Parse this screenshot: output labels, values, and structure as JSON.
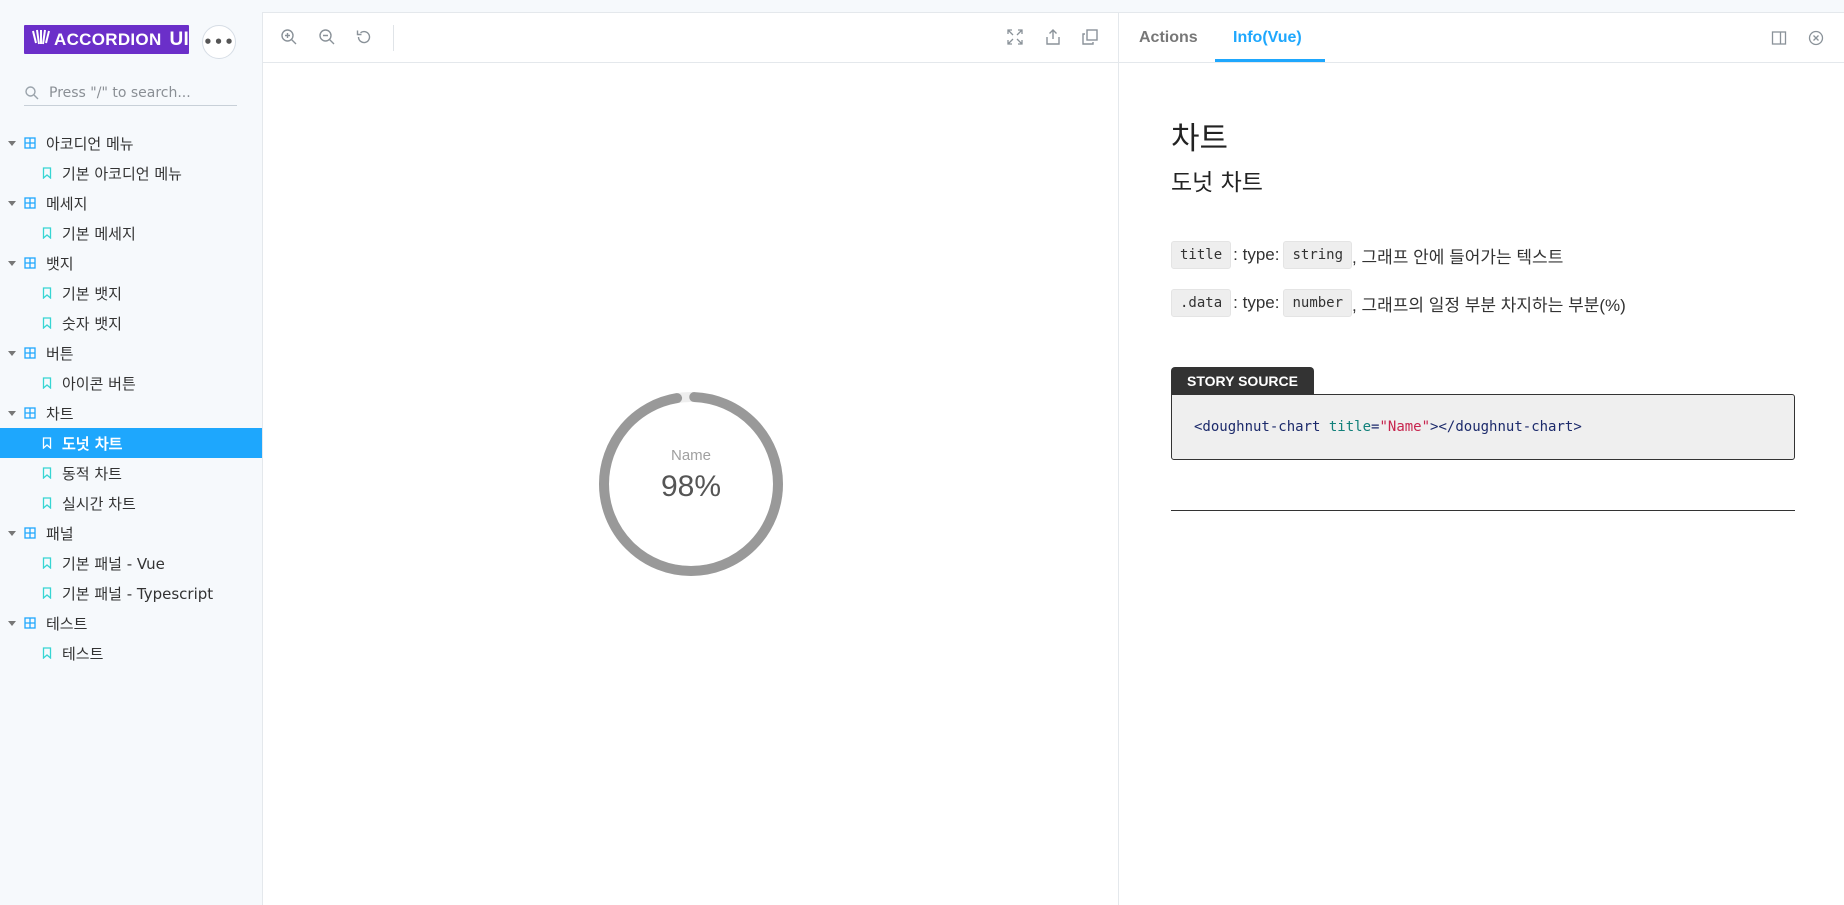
{
  "brand": {
    "logo_text": "ACCORDION",
    "logo_suffix": "UI"
  },
  "menu_button": {
    "label": "•••"
  },
  "search": {
    "placeholder": "Press \"/\" to search..."
  },
  "sidebar": {
    "items": [
      {
        "type": "group",
        "label": "아코디언 메뉴"
      },
      {
        "type": "item",
        "label": "기본 아코디언 메뉴"
      },
      {
        "type": "group",
        "label": "메세지"
      },
      {
        "type": "item",
        "label": "기본 메세지"
      },
      {
        "type": "group",
        "label": "뱃지"
      },
      {
        "type": "item",
        "label": "기본 뱃지"
      },
      {
        "type": "item",
        "label": "숫자 뱃지"
      },
      {
        "type": "group",
        "label": "버튼"
      },
      {
        "type": "item",
        "label": "아이콘 버튼"
      },
      {
        "type": "group",
        "label": "차트"
      },
      {
        "type": "item",
        "label": "도넛 차트",
        "selected": true
      },
      {
        "type": "item",
        "label": "동적 차트"
      },
      {
        "type": "item",
        "label": "실시간 차트"
      },
      {
        "type": "group",
        "label": "패널"
      },
      {
        "type": "item",
        "label": "기본 패널 - Vue"
      },
      {
        "type": "item",
        "label": "기본 패널 - Typescript"
      },
      {
        "type": "group",
        "label": "테스트"
      },
      {
        "type": "item",
        "label": "테스트"
      }
    ]
  },
  "preview": {
    "donut": {
      "label": "Name",
      "value_text": "98%",
      "percent": 98,
      "color": "#999999",
      "track_color": "#eeeeee"
    }
  },
  "addons": {
    "tabs": [
      {
        "label": "Actions",
        "active": false
      },
      {
        "label": "Info(Vue)",
        "active": true
      }
    ]
  },
  "info": {
    "title": "차트",
    "subtitle": "도넛 차트",
    "props": [
      {
        "name": "title",
        "type_label": ": type:",
        "type": "string",
        "desc": ", 그래프 안에 들어가는 텍스트"
      },
      {
        "name": ".data",
        "type_label": ": type:",
        "type": "number",
        "desc": ", 그래프의 일정 부분 차지하는 부분(%)"
      }
    ],
    "source_label": "STORY SOURCE",
    "source": {
      "open": "<doughnut-chart",
      "attr": "title",
      "eq": "=",
      "val": "\"Name\"",
      "close": "></doughnut-chart>"
    }
  },
  "colors": {
    "accent": "#1ea7fd",
    "brand": "#6b2fc9",
    "icon_teal": "#37d5d3",
    "group_icon": "#1ea7fd"
  }
}
